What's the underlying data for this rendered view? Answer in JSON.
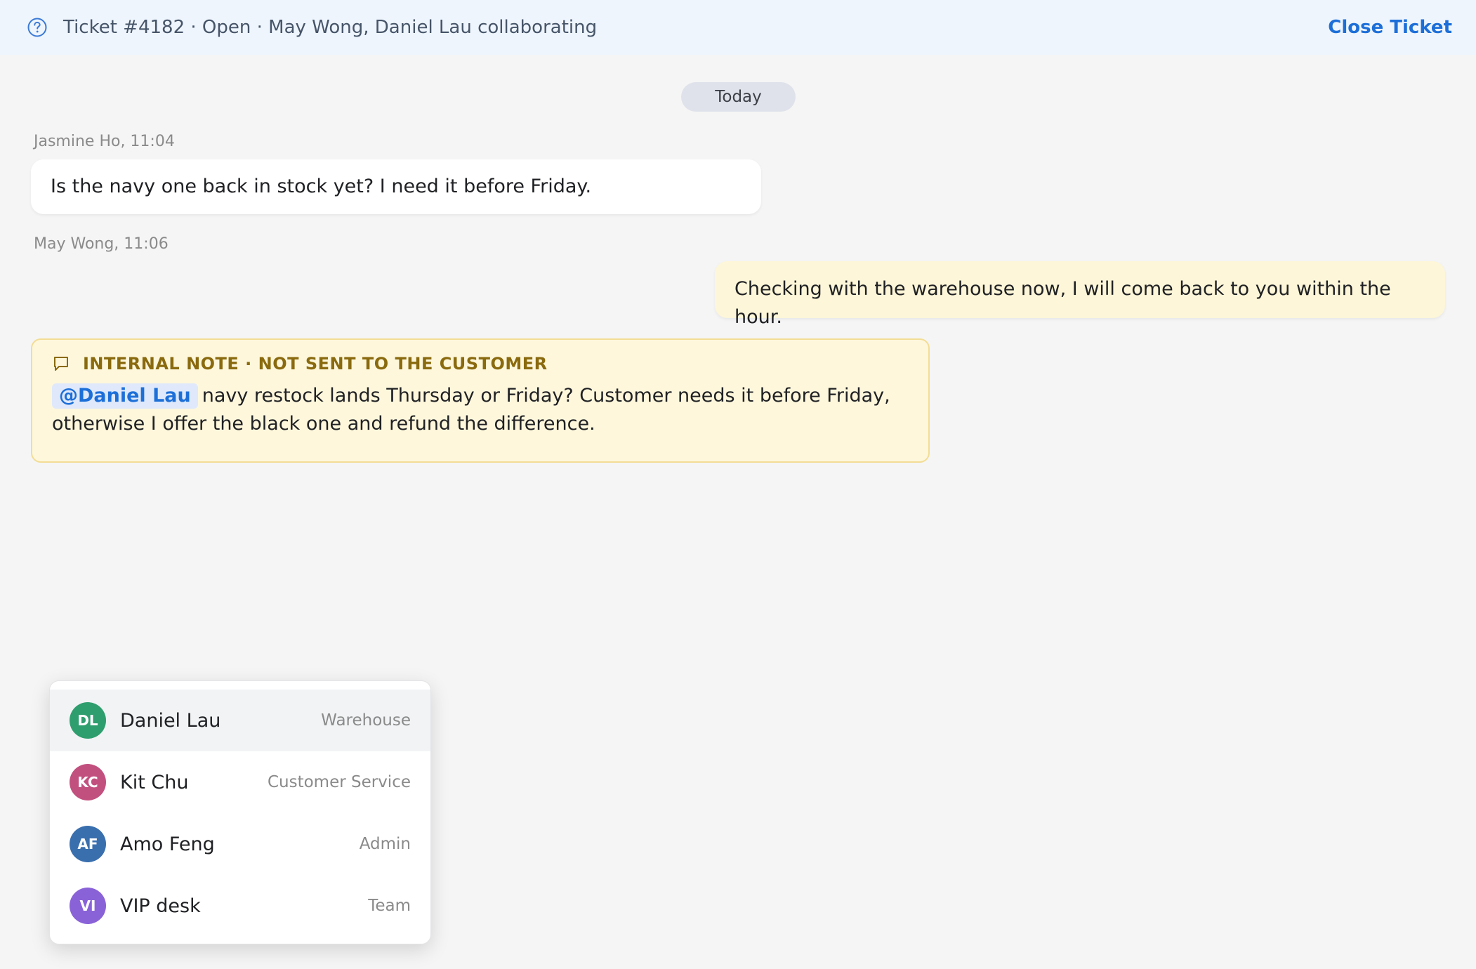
{
  "header": {
    "icon": "help-circle-icon",
    "title": "Ticket #4182 · Open · May Wong, Daniel Lau collaborating",
    "close_label": "Close Ticket"
  },
  "thread": {
    "date_label": "Today",
    "messages": [
      {
        "meta": "Jasmine Ho, 11:04",
        "text": "Is the navy one back in stock yet? I need it before Friday."
      },
      {
        "meta": "May Wong, 11:06",
        "text": "Checking with the warehouse now, I will come back to you within the hour."
      }
    ],
    "note": {
      "icon": "comment-icon",
      "heading": "INTERNAL NOTE · NOT SENT TO THE CUSTOMER",
      "mention": "@Daniel Lau",
      "text": "navy restock lands Thursday or Friday? Customer needs it before Friday, otherwise I offer the black one and refund the difference."
    }
  },
  "mention_dropdown": {
    "items": [
      {
        "initials": "DL",
        "name": "Daniel Lau",
        "role": "Warehouse",
        "color": "#2f9e6e",
        "active": true
      },
      {
        "initials": "KC",
        "name": "Kit Chu",
        "role": "Customer Service",
        "color": "#c2507f",
        "active": false
      },
      {
        "initials": "AF",
        "name": "Amo Feng",
        "role": "Admin",
        "color": "#3a6fae",
        "active": false
      },
      {
        "initials": "VI",
        "name": "VIP desk",
        "role": "Team",
        "color": "#8a62d8",
        "active": false
      }
    ]
  },
  "colors": {
    "accent": "#1d6fd8",
    "note_background": "#fef7dc",
    "note_heading": "#8a6a0e",
    "outgoing_bubble": "#fdf6d8"
  }
}
